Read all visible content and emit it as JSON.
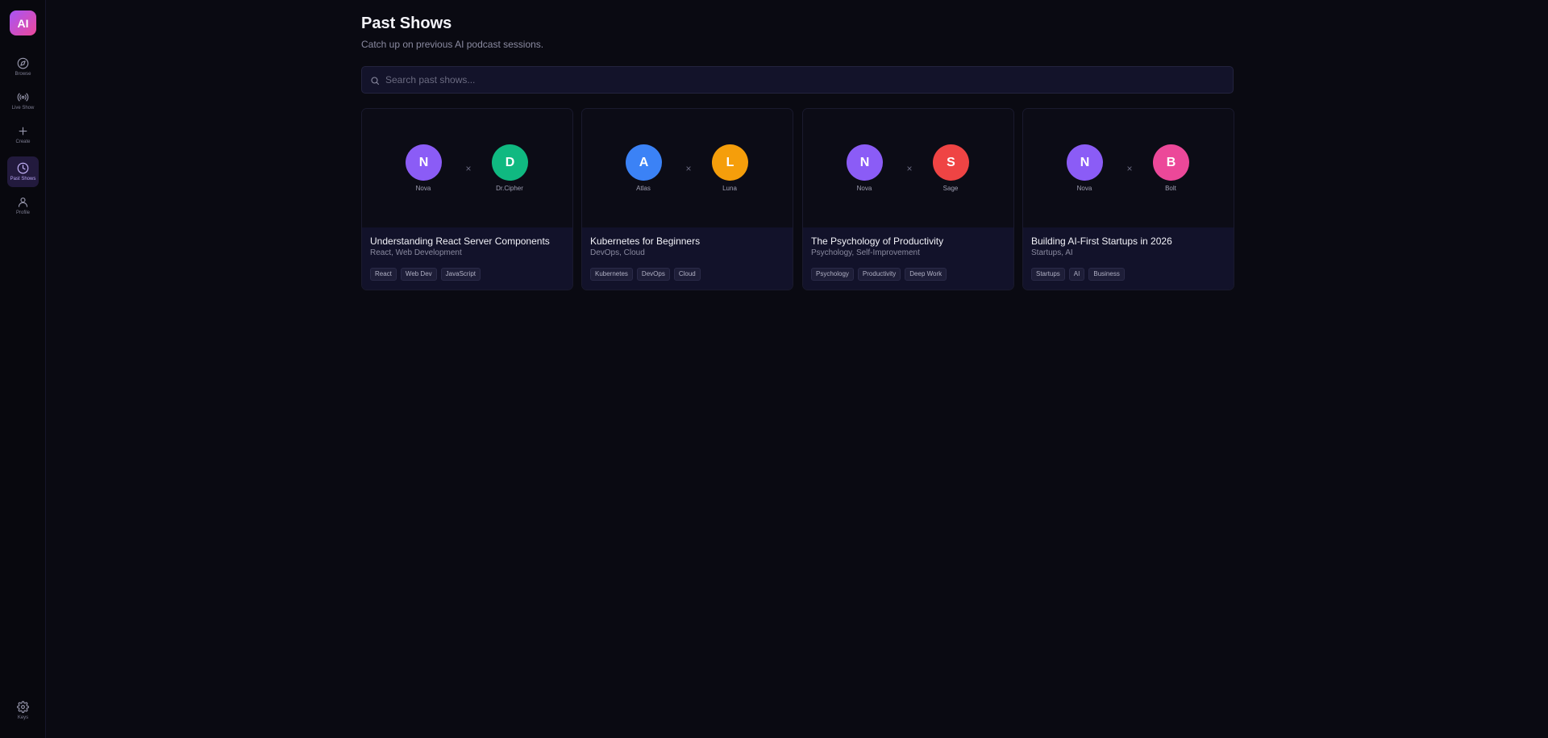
{
  "logo": {
    "text": "AI"
  },
  "nav": {
    "items": [
      {
        "label": "Browse"
      },
      {
        "label": "Live Show"
      },
      {
        "label": "Create"
      },
      {
        "label": "Past Shows"
      },
      {
        "label": "Profile"
      }
    ],
    "keys_label": "Keys"
  },
  "header": {
    "title": "Past Shows",
    "subtitle": "Catch up on previous AI podcast sessions."
  },
  "search": {
    "placeholder": "Search past shows..."
  },
  "shows": [
    {
      "host1": {
        "initial": "N",
        "name": "Nova",
        "color": "#8b5cf6"
      },
      "host2": {
        "initial": "D",
        "name": "Dr.Cipher",
        "color": "#10b981"
      },
      "cross": "×",
      "title": "Understanding React Server Components",
      "categories": "React, Web Development",
      "tags": [
        "React",
        "Web Dev",
        "JavaScript"
      ]
    },
    {
      "host1": {
        "initial": "A",
        "name": "Atlas",
        "color": "#3b82f6"
      },
      "host2": {
        "initial": "L",
        "name": "Luna",
        "color": "#f59e0b"
      },
      "cross": "×",
      "title": "Kubernetes for Beginners",
      "categories": "DevOps, Cloud",
      "tags": [
        "Kubernetes",
        "DevOps",
        "Cloud"
      ]
    },
    {
      "host1": {
        "initial": "N",
        "name": "Nova",
        "color": "#8b5cf6"
      },
      "host2": {
        "initial": "S",
        "name": "Sage",
        "color": "#ef4444"
      },
      "cross": "×",
      "title": "The Psychology of Productivity",
      "categories": "Psychology, Self-Improvement",
      "tags": [
        "Psychology",
        "Productivity",
        "Deep Work"
      ]
    },
    {
      "host1": {
        "initial": "N",
        "name": "Nova",
        "color": "#8b5cf6"
      },
      "host2": {
        "initial": "B",
        "name": "Bolt",
        "color": "#ec4899"
      },
      "cross": "×",
      "title": "Building AI-First Startups in 2026",
      "categories": "Startups, AI",
      "tags": [
        "Startups",
        "AI",
        "Business"
      ]
    }
  ]
}
